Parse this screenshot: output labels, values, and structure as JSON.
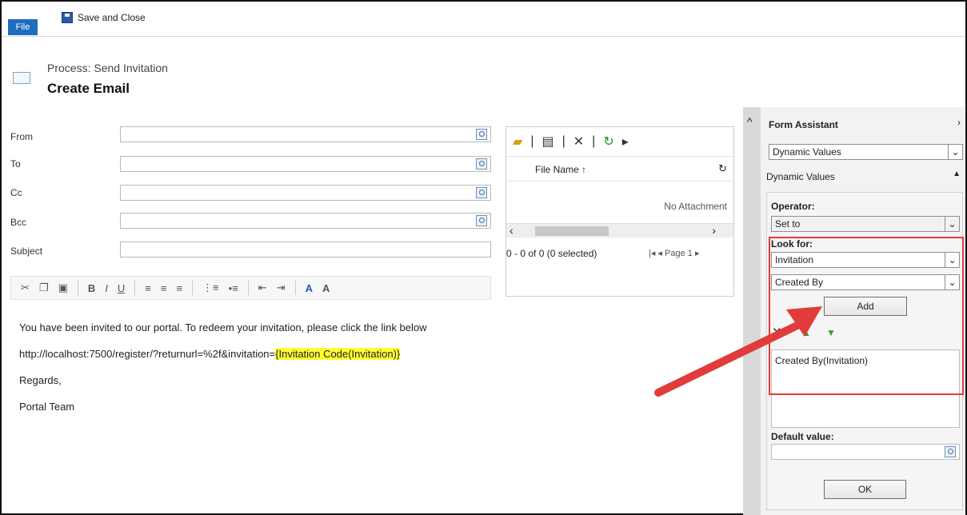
{
  "ribbon": {
    "file_tab": "File",
    "save_close": "Save and Close"
  },
  "header": {
    "process": "Process: Send Invitation",
    "title": "Create Email"
  },
  "fields": {
    "from": "From",
    "to": "To",
    "cc": "Cc",
    "bcc": "Bcc",
    "subject": "Subject"
  },
  "toolbar": {
    "bold": "B",
    "italic": "I",
    "underline": "U"
  },
  "body": {
    "line1": "You have been invited to our portal. To redeem your invitation, please click the link below",
    "url": "http://localhost:7500/register/?returnurl=%2f&invitation=",
    "token": "{Invitation Code(Invitation)}",
    "regards": "Regards,",
    "team": "Portal Team"
  },
  "attachments": {
    "file_name": "File Name ↑",
    "empty": "No Attachment",
    "paging": "0 - 0 of 0 (0 selected)",
    "page": "Page 1"
  },
  "assistant": {
    "title": "Form Assistant",
    "dropdown": "Dynamic Values",
    "section": "Dynamic Values",
    "operator_label": "Operator:",
    "operator_value": "Set to",
    "look_for_label": "Look for:",
    "look_for_value": "Invitation",
    "attribute_value": "Created By",
    "add_label": "Add",
    "selected_item": "Created By(Invitation)",
    "default_label": "Default value:",
    "ok_label": "OK"
  }
}
